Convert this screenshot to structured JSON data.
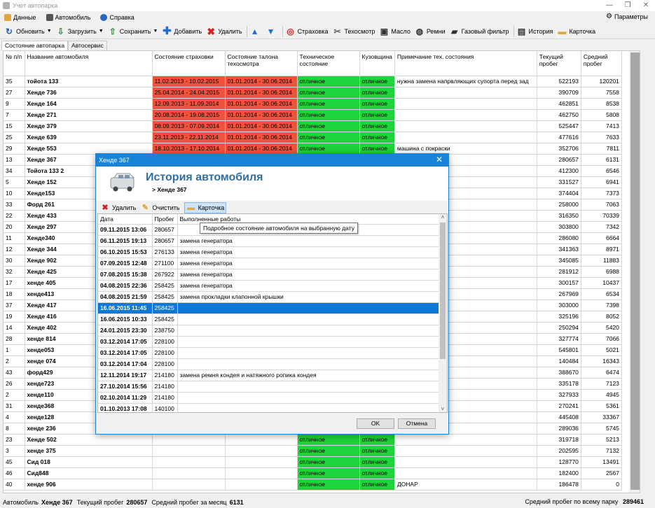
{
  "window": {
    "title": "Учет автопарка"
  },
  "menu": {
    "items": [
      "Данные",
      "Автомобиль",
      "Справка"
    ],
    "params": "Параметры"
  },
  "toolbar": {
    "refresh": "Обновить",
    "load": "Загрузить",
    "save": "Сохранить",
    "add": "Добавить",
    "delete": "Удалить",
    "insurance": "Страховка",
    "inspection": "Техосмотр",
    "oil": "Масло",
    "belts": "Ремни",
    "gas_filter": "Газовый фильтр",
    "history": "История",
    "card": "Карточка"
  },
  "tabs": [
    "Состояние автопарка",
    "Автосервис"
  ],
  "grid": {
    "headers": [
      "№ п/п",
      "Название автомобиля",
      "Состояние страховки",
      "Состояние талона техосмотра",
      "Техническое состояние",
      "Кузовщина",
      "Примечание тех. состояния",
      "Текущий пробег",
      "Средний пробег"
    ],
    "rows": [
      [
        "35",
        "тойота 133",
        "11.02.2013 - 10.02.2015",
        "01.01.2014 - 30.06.2014",
        "отличное",
        "отличное",
        "нужна замена напрвляющих супорта перед зад",
        "522193",
        "120201"
      ],
      [
        "27",
        "Хенде 736",
        "25.04.2014 - 24.04.2015",
        "01.01.2014 - 30.06.2014",
        "отличное",
        "отличное",
        "",
        "390709",
        "7558"
      ],
      [
        "9",
        "Хенде 164",
        "12.09.2013 - 11.09.2014",
        "01.01.2014 - 30.06.2014",
        "отличное",
        "отличное",
        "",
        "462851",
        "8538"
      ],
      [
        "7",
        "Хенде 271",
        "20.08.2014 - 19.08.2015",
        "01.01.2014 - 30.06.2014",
        "отличное",
        "отличное",
        "",
        "462750",
        "5808"
      ],
      [
        "15",
        "Хенде 379",
        "08.09.2013 - 07.09.2014",
        "01.01.2014 - 30.06.2014",
        "отличное",
        "отличное",
        "",
        "525447",
        "7413"
      ],
      [
        "25",
        "Хенде 639",
        "23.11.2013 - 22.11.2014",
        "01.01.2014 - 30.06.2014",
        "отличное",
        "отличное",
        "",
        "477616",
        "7633"
      ],
      [
        "29",
        "Хенде 553",
        "18.10.2013 - 17.10.2014",
        "01.01.2014 - 30.06.2014",
        "отличное",
        "отличное",
        "машина с покраски",
        "352706",
        "7811"
      ],
      [
        "13",
        "Хенде 367",
        "",
        "",
        "",
        "",
        "",
        "280657",
        "6131"
      ],
      [
        "34",
        "Тойота 133 2",
        "",
        "",
        "",
        "",
        "",
        "412300",
        "6546"
      ],
      [
        "5",
        "Хенде 152",
        "",
        "",
        "",
        "",
        "дуктора газового",
        "331527",
        "6941"
      ],
      [
        "10",
        "Хенде153",
        "",
        "",
        "",
        "",
        "",
        "374404",
        "7373"
      ],
      [
        "33",
        "Форд 261",
        "",
        "",
        "",
        "",
        "",
        "258000",
        "7063"
      ],
      [
        "22",
        "Хенде 433",
        "",
        "",
        "",
        "",
        "",
        "316350",
        "70339"
      ],
      [
        "20",
        "Хенде 297",
        "",
        "",
        "",
        "",
        "",
        "303800",
        "7342"
      ],
      [
        "11",
        "Хенде340",
        "",
        "",
        "",
        "",
        "",
        "286080",
        "6664"
      ],
      [
        "12",
        "Хенде 344",
        "",
        "",
        "",
        "",
        "",
        "341363",
        "8971"
      ],
      [
        "30",
        "Хенде 902",
        "",
        "",
        "",
        "",
        "",
        "345085",
        "11883"
      ],
      [
        "32",
        "Хенде 425",
        "",
        "",
        "",
        "",
        "",
        "281912",
        "6988"
      ],
      [
        "17",
        "хенде 405",
        "",
        "",
        "",
        "",
        "",
        "300157",
        "10437"
      ],
      [
        "18",
        "хенде413",
        "",
        "",
        "",
        "",
        "ышка",
        "267969",
        "6534"
      ],
      [
        "37",
        "Хенде 417",
        "",
        "",
        "",
        "",
        "",
        "303000",
        "7398"
      ],
      [
        "19",
        "Хенде 416",
        "",
        "",
        "",
        "",
        "",
        "325196",
        "8052"
      ],
      [
        "14",
        "Хенде 402",
        "",
        "",
        "",
        "",
        "",
        "250294",
        "5420"
      ],
      [
        "28",
        "хенде 814",
        "",
        "",
        "",
        "",
        "",
        "327774",
        "7066"
      ],
      [
        "1",
        "хенде053",
        "",
        "",
        "",
        "",
        "",
        "545801",
        "5021"
      ],
      [
        "2",
        "хенде 074",
        "",
        "",
        "",
        "",
        "третьем цилиндре",
        "140484",
        "16343"
      ],
      [
        "43",
        "форд429",
        "",
        "",
        "",
        "",
        "",
        "388670",
        "6474"
      ],
      [
        "26",
        "хенде723",
        "",
        "",
        "",
        "",
        "",
        "335178",
        "7123"
      ],
      [
        "2",
        "хенде110",
        "",
        "",
        "",
        "",
        "втором целиндре",
        "327933",
        "4945"
      ],
      [
        "31",
        "хенде368",
        "",
        "",
        "",
        "",
        "",
        "270241",
        "5361"
      ],
      [
        "4",
        "хенде128",
        "",
        "",
        "",
        "",
        "",
        "445408",
        "33367"
      ],
      [
        "8",
        "хенде 236",
        "",
        "",
        "",
        "",
        "",
        "289036",
        "5745"
      ],
      [
        "23",
        "Хенде 502",
        "",
        "",
        "отличное",
        "отличное",
        "",
        "319718",
        "5213"
      ],
      [
        "3",
        "хенде 375",
        "",
        "",
        "отличное",
        "отличное",
        "",
        "202595",
        "7132"
      ],
      [
        "45",
        "Сид 018",
        "",
        "",
        "отличное",
        "отличное",
        "",
        "128770",
        "13491"
      ],
      [
        "46",
        "Сид848",
        "",
        "",
        "отличное",
        "отличное",
        "",
        "182400",
        "2567"
      ],
      [
        "40",
        "хенде 906",
        "",
        "",
        "отличное",
        "отличное",
        "ДОНАР",
        "186478",
        "0"
      ]
    ]
  },
  "status": {
    "car_label": "Автомобиль",
    "car": "Хенде 367",
    "cur_label": "Текущий пробег",
    "cur": "280657",
    "avg_label": "Средний пробег за месяц",
    "avg": "6131",
    "fleet_label": "Средний пробег по всему парку",
    "fleet": "289461"
  },
  "dialog": {
    "title": "Хенде 367",
    "heading": "История автомобиля",
    "sub": "> Хенде 367",
    "tools": {
      "delete": "Удалить",
      "clear": "Очистить",
      "card": "Карточка"
    },
    "tooltip": "Подробное состояние автомобиля на выбранную дату",
    "headers": [
      "Дата",
      "Пробег",
      "Выполненные работы"
    ],
    "rows": [
      [
        "09.11.2015 13:06",
        "280657",
        ""
      ],
      [
        "06.11.2015 19:13",
        "280657",
        "замена генератора"
      ],
      [
        "06.10.2015 15:53",
        "276133",
        "замена генератора"
      ],
      [
        "07.09.2015 12:48",
        "271100",
        "замена генератора"
      ],
      [
        "07.08.2015 15:38",
        "267922",
        "замена генератора"
      ],
      [
        "04.08.2015 22:36",
        "258425",
        "замена генератора"
      ],
      [
        "04.08.2015 21:59",
        "258425",
        "замена прокладки клапонной крышки"
      ],
      [
        "16.06.2015 11:45",
        "258425",
        ""
      ],
      [
        "16.06.2015 10:33",
        "258425",
        ""
      ],
      [
        "24.01.2015 23:30",
        "238750",
        ""
      ],
      [
        "03.12.2014 17:05",
        "228100",
        ""
      ],
      [
        "03.12.2014 17:05",
        "228100",
        ""
      ],
      [
        "03.12.2014 17:04",
        "228100",
        ""
      ],
      [
        "12.11.2014 19:17",
        "214180",
        "замена ремня кондея и натяжного ропика кондея"
      ],
      [
        "27.10.2014 15:56",
        "214180",
        ""
      ],
      [
        "02.10.2014 11:29",
        "214180",
        ""
      ],
      [
        "01.10.2013 17:08",
        "140100",
        ""
      ]
    ],
    "selected_row": 7,
    "ok": "OK",
    "cancel": "Отмена"
  }
}
